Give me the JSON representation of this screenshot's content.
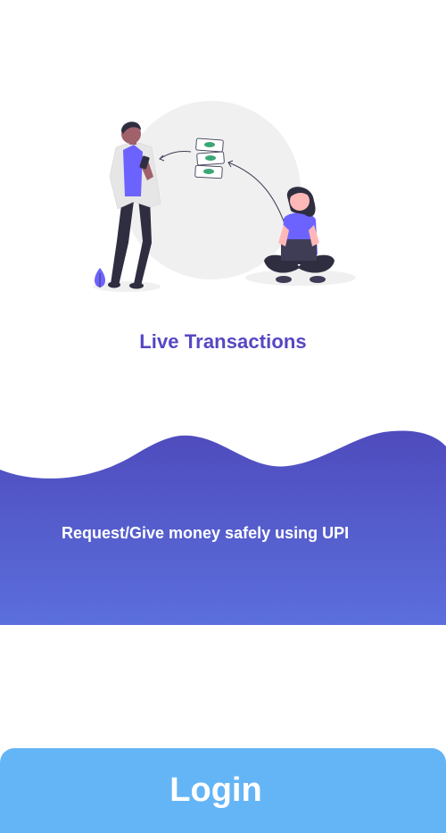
{
  "onboarding": {
    "title": "Live Transactions",
    "subtitle": "Request/Give money safely using UPI"
  },
  "actions": {
    "login_label": "Login"
  },
  "colors": {
    "title": "#5547c3",
    "wave_top": "#4f4bbd",
    "wave_bottom": "#5b6fdc",
    "login_button": "#64b5f6",
    "illustration_accent": "#6c63ff"
  }
}
